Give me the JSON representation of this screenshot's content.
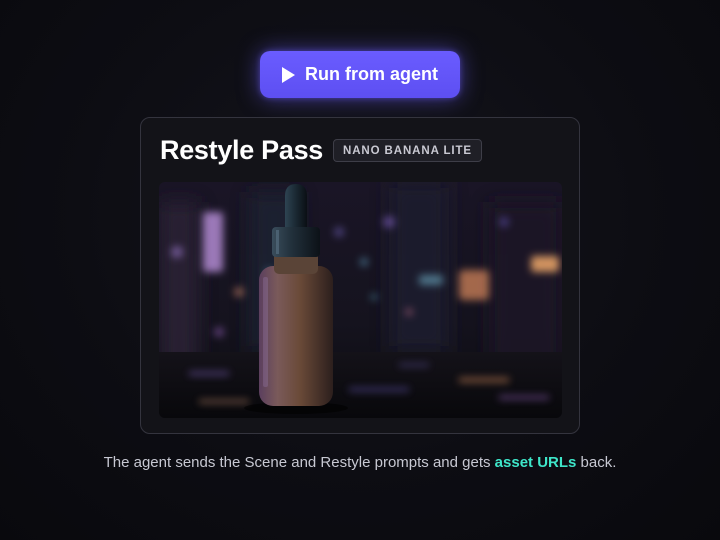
{
  "run_button": {
    "label": "Run from agent",
    "icon": "play-icon"
  },
  "card": {
    "title": "Restyle Pass",
    "badge": "NANO BANANA LITE",
    "image": {
      "subject": "amber dropper bottle on wet street at night with neon bokeh"
    }
  },
  "caption": {
    "text_before": "The agent sends the Scene and Restyle prompts and gets ",
    "link_text": "asset URLs",
    "text_after": " back."
  },
  "colors": {
    "accent_button": "#6a5cff",
    "accent_link": "#3ee6c9",
    "background": "#0d0d13"
  }
}
